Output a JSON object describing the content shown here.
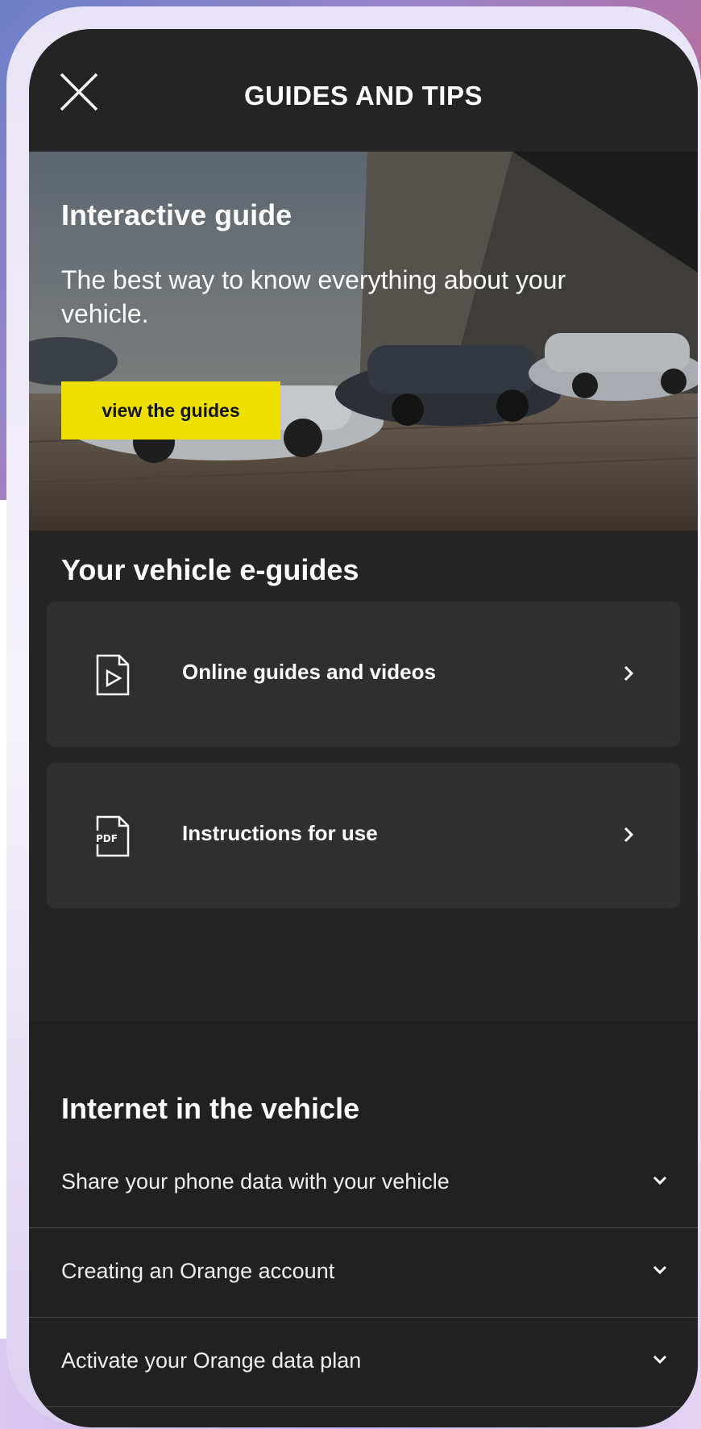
{
  "header": {
    "title": "GUIDES AND TIPS",
    "close_icon": "close-icon"
  },
  "hero": {
    "title": "Interactive guide",
    "subtitle": "The best way to know everything about your vehicle.",
    "button_label": "view the guides",
    "button_color": "#efdf00"
  },
  "eguides": {
    "title": "Your vehicle e-guides",
    "items": [
      {
        "label": "Online guides and videos",
        "icon": "video-file-icon"
      },
      {
        "label": "Instructions for use",
        "icon": "pdf-file-icon",
        "icon_text": "PDF"
      }
    ]
  },
  "internet": {
    "title": "Internet in the vehicle",
    "items": [
      {
        "label": "Share your phone data with your vehicle"
      },
      {
        "label": "Creating an Orange account"
      },
      {
        "label": "Activate your Orange data plan"
      }
    ]
  }
}
